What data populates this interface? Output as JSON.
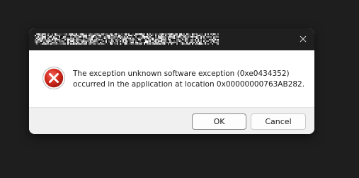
{
  "dialog": {
    "title": "",
    "title_obscured": true,
    "close_icon": "close-icon",
    "error_icon": "error-icon",
    "message_line1": "The exception unknown software exception (0xe0434352)",
    "message_line2": "occurred in the application at location 0x00000000763AB282.",
    "ok_label": "OK",
    "cancel_label": "Cancel"
  },
  "colors": {
    "titlebar": "#1f1f1f",
    "body": "#ffffff",
    "footer": "#f0f0f0",
    "error_red": "#c42b1c",
    "background": "#1e1e1e"
  }
}
